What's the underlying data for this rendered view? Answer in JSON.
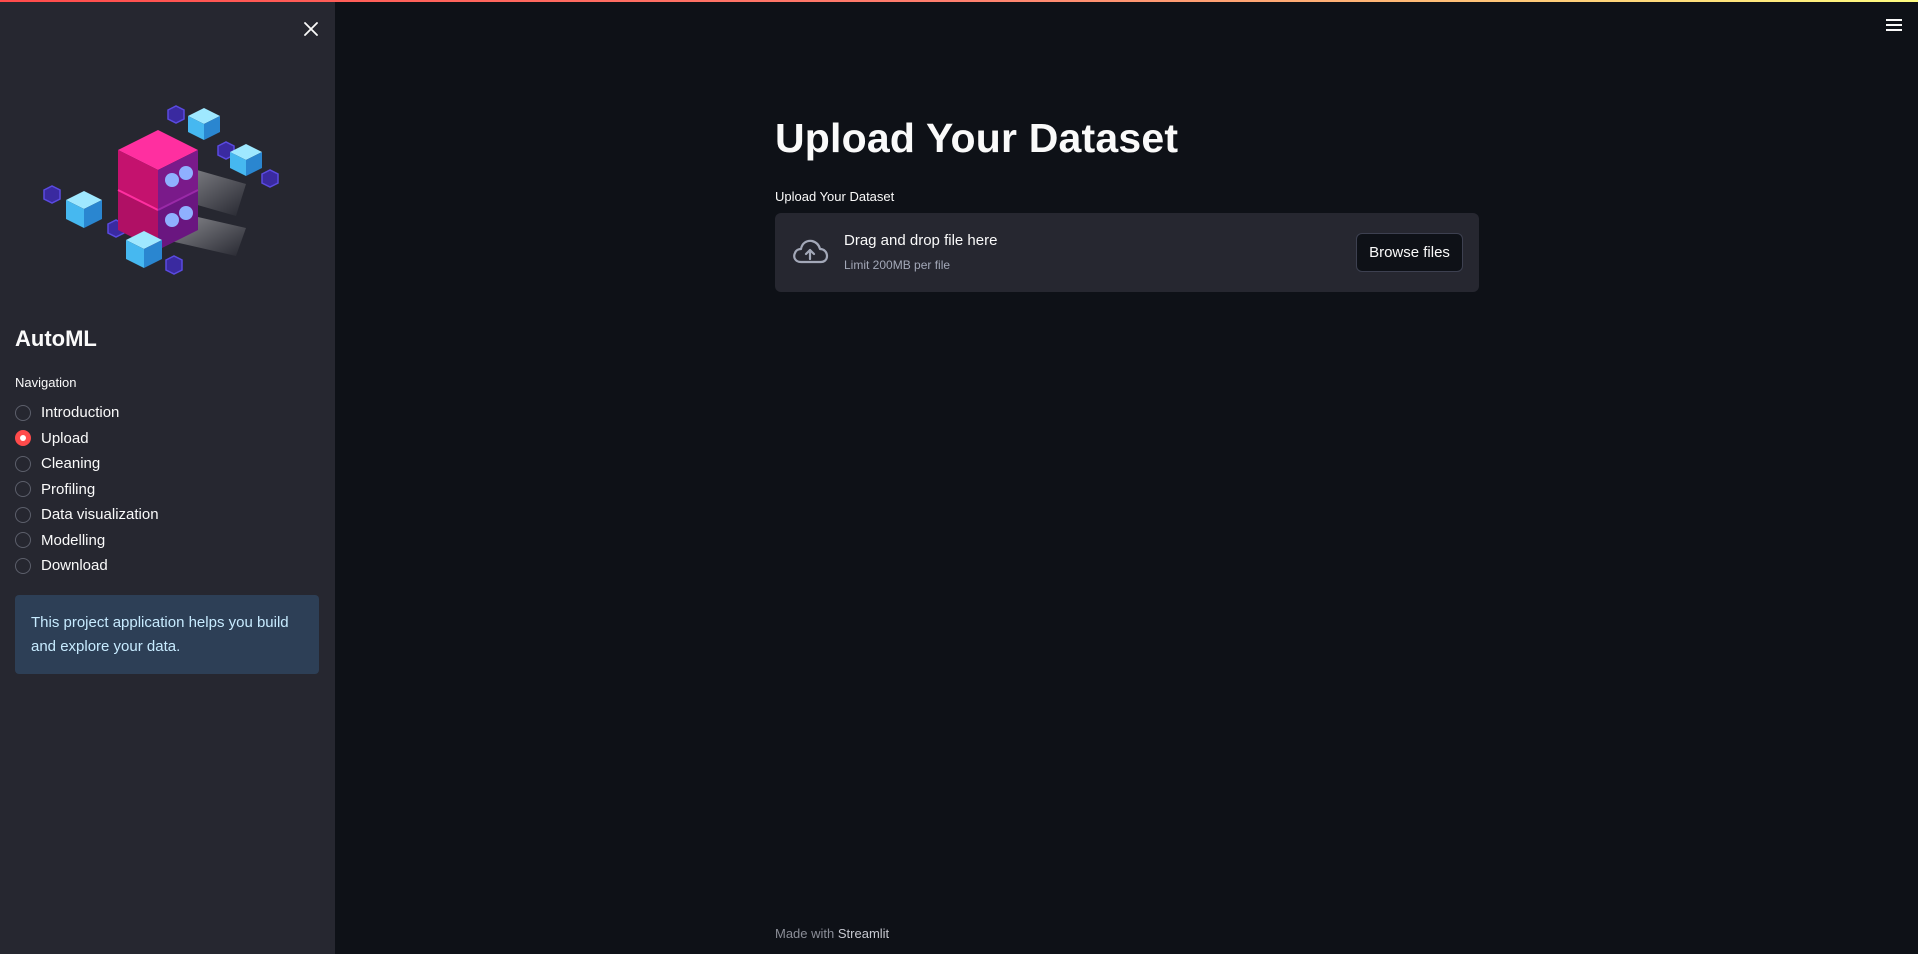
{
  "colors": {
    "primary": "#ff4b4b",
    "background": "#0e1117",
    "sidebar_background": "#262730",
    "info_background": "#2d3f56",
    "info_text": "#c7ebff"
  },
  "sidebar": {
    "close_icon": "close-icon",
    "logo_icon": "isometric-server-cubes-illustration",
    "app_title": "AutoML",
    "nav_label": "Navigation",
    "nav_items": [
      {
        "label": "Introduction",
        "selected": false
      },
      {
        "label": "Upload",
        "selected": true
      },
      {
        "label": "Cleaning",
        "selected": false
      },
      {
        "label": "Profiling",
        "selected": false
      },
      {
        "label": "Data visualization",
        "selected": false
      },
      {
        "label": "Modelling",
        "selected": false
      },
      {
        "label": "Download",
        "selected": false
      }
    ],
    "info_text": "This project application helps you build and explore your data."
  },
  "header": {
    "menu_icon": "hamburger-menu-icon"
  },
  "main": {
    "title": "Upload Your Dataset",
    "uploader": {
      "label": "Upload Your Dataset",
      "icon": "cloud-upload-icon",
      "drop_text": "Drag and drop file here",
      "limit_text": "Limit 200MB per file",
      "browse_label": "Browse files"
    }
  },
  "footer": {
    "prefix": "Made with",
    "brand": "Streamlit"
  }
}
